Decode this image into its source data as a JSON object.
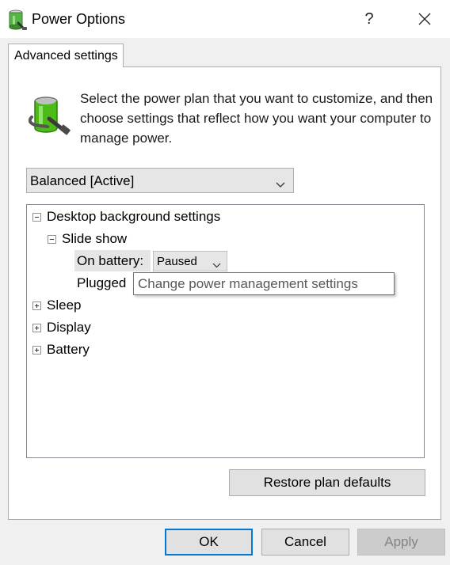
{
  "window": {
    "title": "Power Options",
    "help_label": "?",
    "icons": {
      "app": "power-options-battery-icon",
      "close": "close-icon"
    }
  },
  "tab": {
    "label": "Advanced settings"
  },
  "description": "Select the power plan that you want to customize, and then choose settings that reflect how you want your computer to manage power.",
  "plan_select": {
    "value": "Balanced [Active]"
  },
  "tree": {
    "desktop_background": {
      "label": "Desktop background settings",
      "expanded": true
    },
    "slide_show": {
      "label": "Slide show",
      "expanded": true
    },
    "on_battery": {
      "label": "On battery:",
      "value": "Paused"
    },
    "plugged_in": {
      "label": "Plugged"
    },
    "sleep": {
      "label": "Sleep",
      "expanded": false
    },
    "display": {
      "label": "Display",
      "expanded": false
    },
    "battery": {
      "label": "Battery",
      "expanded": false
    }
  },
  "tooltip": "Change power management settings",
  "buttons": {
    "restore": "Restore plan defaults",
    "ok": "OK",
    "cancel": "Cancel",
    "apply": "Apply"
  },
  "colors": {
    "focus_border": "#0078d7",
    "battery_green": "#4cbb17"
  }
}
